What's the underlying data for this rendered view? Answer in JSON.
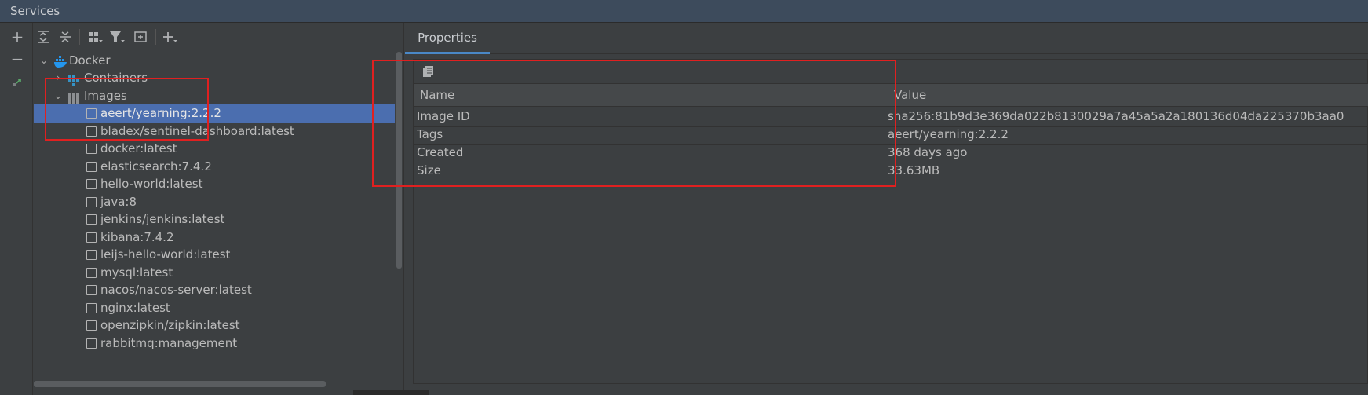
{
  "window": {
    "title": "Services"
  },
  "left_strip": {
    "add_label": "+",
    "remove_label": "−"
  },
  "tree": {
    "root": {
      "label": "Docker"
    },
    "containers": {
      "label": "Containers"
    },
    "images": {
      "label": "Images"
    },
    "items": [
      "aeert/yearning:2.2.2",
      "bladex/sentinel-dashboard:latest",
      "docker:latest",
      "elasticsearch:7.4.2",
      "hello-world:latest",
      "java:8",
      "jenkins/jenkins:latest",
      "kibana:7.4.2",
      "leijs-hello-world:latest",
      "mysql:latest",
      "nacos/nacos-server:latest",
      "nginx:latest",
      "openzipkin/zipkin:latest",
      "rabbitmq:management"
    ],
    "selected_index": 0
  },
  "properties": {
    "tab_label": "Properties",
    "columns": {
      "name": "Name",
      "value": "Value"
    },
    "rows": [
      {
        "name": "Image ID",
        "value": "sha256:81b9d3e369da022b8130029a7a45a5a2a180136d04da225370b3aa0"
      },
      {
        "name": "Tags",
        "value": "aeert/yearning:2.2.2"
      },
      {
        "name": "Created",
        "value": "368 days ago"
      },
      {
        "name": "Size",
        "value": "33.63MB"
      }
    ]
  },
  "colors": {
    "selection": "#4b6eaf",
    "annotation": "#e02020",
    "docker_blue": "#2496ed",
    "accent": "#4a88c7"
  }
}
